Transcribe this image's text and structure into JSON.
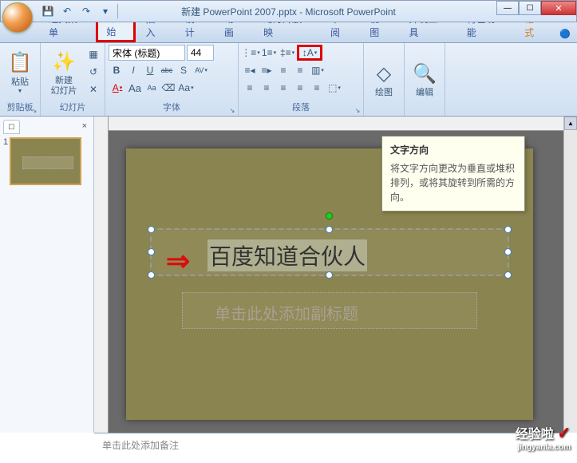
{
  "window": {
    "title": "新建 PowerPoint 2007.pptx - Microsoft PowerPoint"
  },
  "qat": {
    "save": "💾",
    "undo": "↶",
    "redo": "↷"
  },
  "tabs": {
    "classic": "经典菜单",
    "home": "开始",
    "insert": "插入",
    "design": "设计",
    "anim": "动画",
    "slideshow": "幻灯片放映",
    "review": "审阅",
    "view": "视图",
    "dev": "开发工具",
    "special": "特色功能",
    "format": "格式"
  },
  "ribbon": {
    "clipboard": {
      "label": "剪贴板",
      "paste": "粘贴"
    },
    "slides": {
      "label": "幻灯片",
      "new_slide": "新建\n幻灯片"
    },
    "font": {
      "label": "字体",
      "name": "宋体 (标题)",
      "size": "44",
      "bold": "B",
      "italic": "I",
      "underline": "U",
      "strike": "abc",
      "shadow": "S",
      "spacing": "AV",
      "color": "A",
      "grow": "Aa",
      "shrink": "Aa",
      "clear": "⌫",
      "case": "Aa"
    },
    "paragraph": {
      "label": "段落"
    },
    "drawing": {
      "label": "绘图"
    },
    "editing": {
      "label": "编辑"
    }
  },
  "tooltip": {
    "title": "文字方向",
    "body": "将文字方向更改为垂直或堆积排列，或将其旋转到所需的方向。"
  },
  "slide_panel": {
    "tab_outline": "□",
    "tab_close": "×",
    "slide_num": "1"
  },
  "slide": {
    "title_text": "百度知道合伙人",
    "subtitle_placeholder": "单击此处添加副标题"
  },
  "notes": {
    "placeholder": "单击此处添加备注"
  },
  "watermark": {
    "brand": "经验啦",
    "url": "jingyanla.com"
  }
}
